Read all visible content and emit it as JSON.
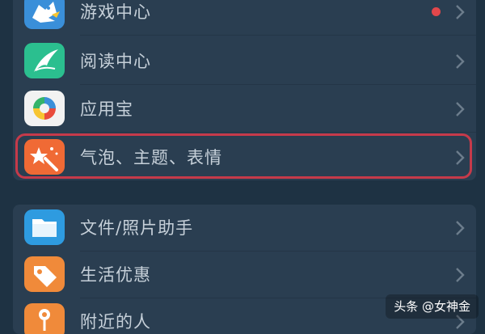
{
  "colors": {
    "background": "#1e3243",
    "card": "#2a3e51",
    "label_text": "#c6d0d9",
    "highlight_border": "#c63a4a",
    "notification_dot": "#e2474b"
  },
  "groups": [
    {
      "items": [
        {
          "label": "游戏中心",
          "icon": "game-center-icon",
          "icon_color": "#3a8fd9",
          "has_notification_dot": true
        },
        {
          "label": "阅读中心",
          "icon": "reading-center-icon",
          "icon_color": "#2bbf8f"
        },
        {
          "label": "应用宝",
          "icon": "app-store-icon",
          "icon_color": "#f2f2f2"
        },
        {
          "label": "气泡、主题、表情",
          "icon": "bubble-theme-emoji-icon",
          "icon_color": "#f06a35",
          "highlighted": true
        }
      ]
    },
    {
      "items": [
        {
          "label": "文件/照片助手",
          "icon": "file-photo-assistant-icon",
          "icon_color": "#2e9be0"
        },
        {
          "label": "生活优惠",
          "icon": "life-deals-icon",
          "icon_color": "#f08a3a"
        },
        {
          "label": "附近的人",
          "icon": "nearby-people-icon",
          "icon_color": "#f08a3a"
        }
      ]
    }
  ],
  "watermark": "头条 @女神金"
}
